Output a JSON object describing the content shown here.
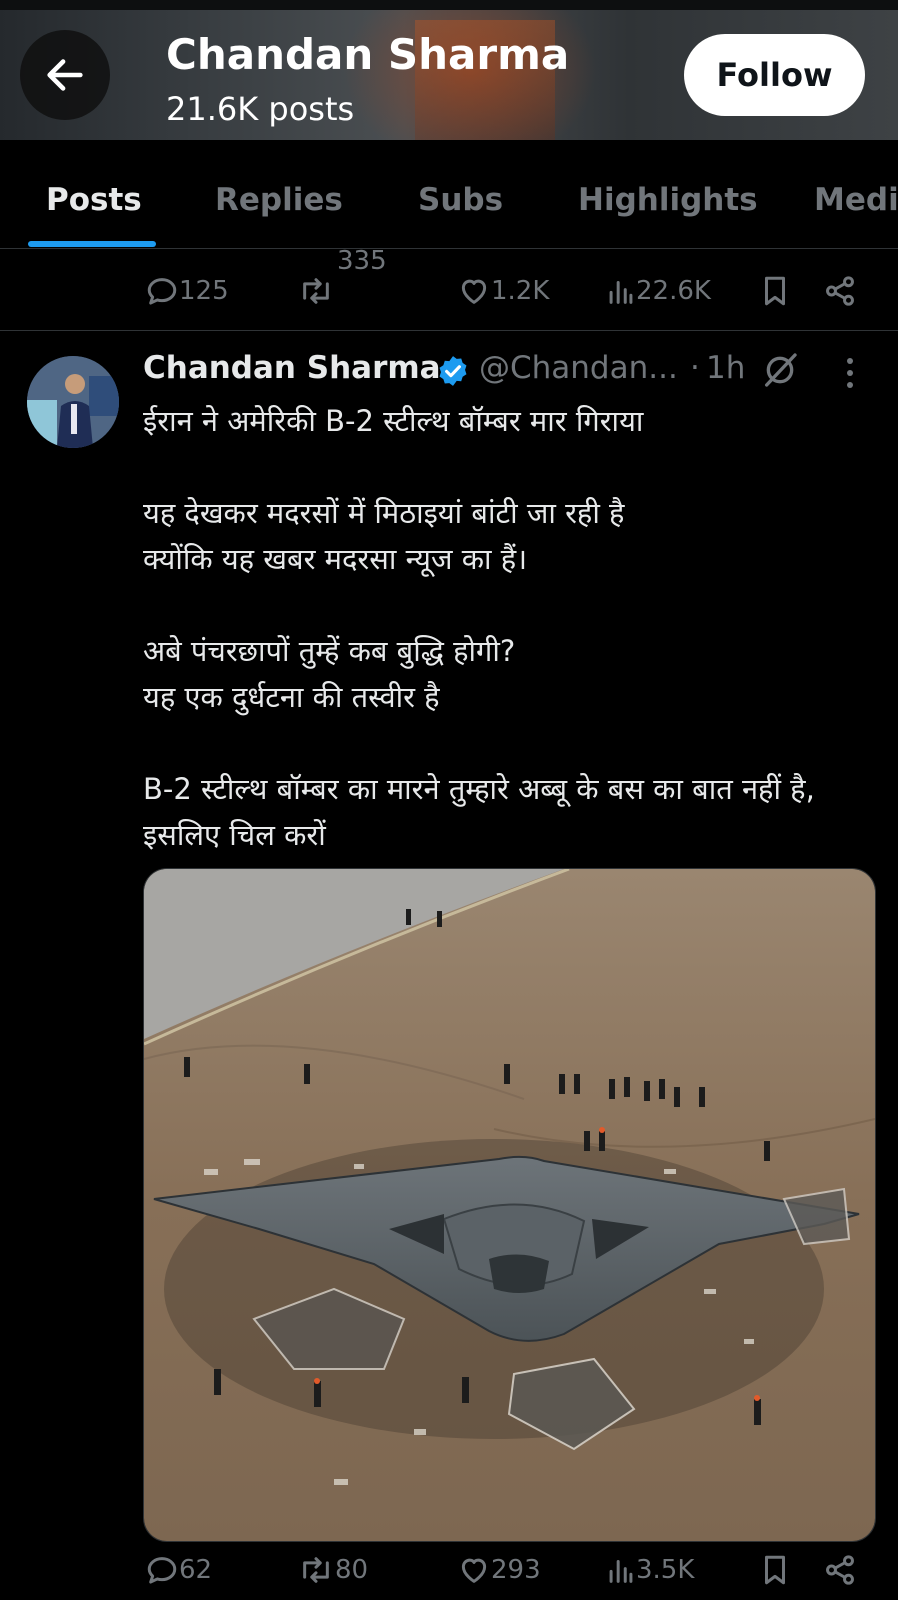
{
  "header": {
    "title": "Chandan Sharma",
    "posts_count": "21.6K posts",
    "follow_label": "Follow"
  },
  "tabs": [
    {
      "label": "Posts",
      "active": true
    },
    {
      "label": "Replies",
      "active": false
    },
    {
      "label": "Subs",
      "active": false
    },
    {
      "label": "Highlights",
      "active": false
    },
    {
      "label": "Medi",
      "active": false
    }
  ],
  "prev_post": {
    "replies": "125",
    "reposts": "335",
    "likes": "1.2K",
    "views": "22.6K"
  },
  "post": {
    "author_name": "Chandan Sharma",
    "verified": true,
    "handle": "@Chandan...",
    "separator": "·",
    "time": "1h",
    "lines": [
      "ईरान ने अमेरिकी B-2 स्टील्थ बॉम्बर मार गिराया",
      "यह देखकर मदरसों में मिठाइयां बांटी जा रही है",
      "क्योंकि यह खबर मदरसा न्यूज का हैं।",
      "अबे पंचरछापों तुम्हें कब बुद्धि होगी?",
      "यह एक दुर्धटना की तस्वीर है",
      "B-2 स्टील्थ बॉम्बर का मारने तुम्हारे अब्बू के बस का बात नहीं है, इसलिए चिल करों"
    ],
    "replies": "62",
    "reposts": "80",
    "likes": "293",
    "views": "3.5K"
  },
  "icons": {
    "back": "arrow-left-icon",
    "reply": "reply-icon",
    "repost": "repost-icon",
    "like": "heart-icon",
    "views": "views-icon",
    "bookmark": "bookmark-icon",
    "share": "share-icon",
    "verified": "verified-badge-icon",
    "grok": "grok-icon",
    "more": "more-vertical-icon"
  },
  "colors": {
    "background": "#000000",
    "text": "#e7e9ea",
    "muted": "#71767b",
    "accent": "#1d9bf0",
    "divider": "#2f3336"
  }
}
